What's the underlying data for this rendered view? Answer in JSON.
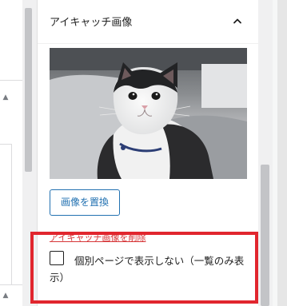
{
  "panel": {
    "title": "アイキャッチ画像",
    "toggle_icon": "chevron-up-icon",
    "replace_button_label": "画像を置換",
    "remove_link_label": "アイキャッチ画像を削除",
    "checkbox": {
      "label": "個別ページで表示しない（一覧のみ表示）",
      "checked": false
    }
  },
  "colors": {
    "accent": "#2271b1",
    "remove_link": "#d63638",
    "highlight": "#e1262e"
  }
}
